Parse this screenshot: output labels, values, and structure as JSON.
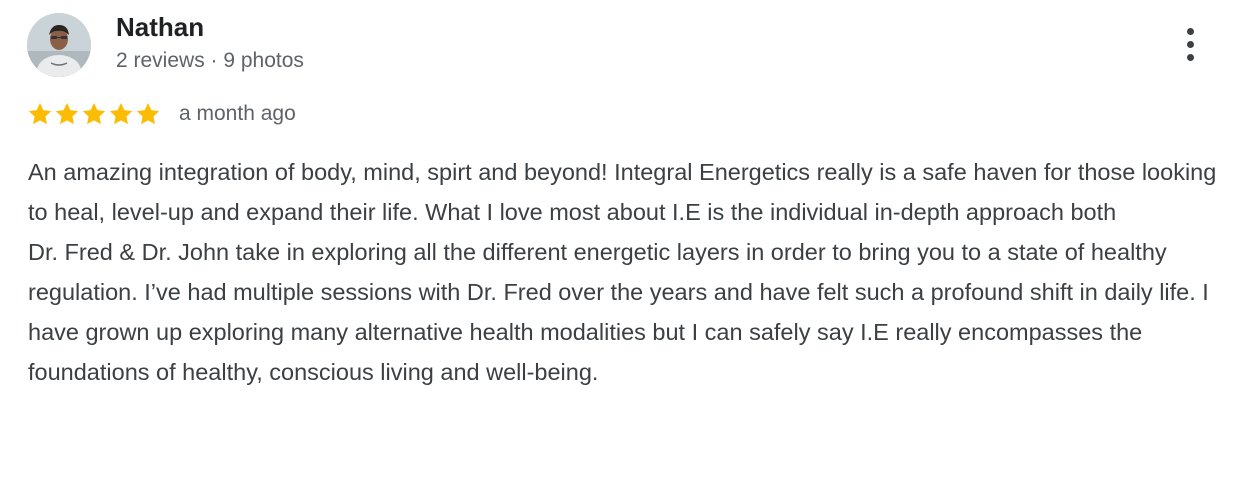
{
  "reviewer": {
    "name": "Nathan",
    "meta": "2 reviews · 9 photos",
    "avatar_icon": "user-photo-avatar"
  },
  "rating": {
    "stars": 5,
    "max_stars": 5,
    "star_color": "#fbbc04",
    "date": "a month ago"
  },
  "menu": {
    "icon": "more-vert-icon"
  },
  "review": {
    "paragraphs": [
      "An amazing integration of body, mind, spirt and beyond! Integral Energetics really is a safe haven for those looking to heal, level-up and expand their life. What I love most about I.E is the individual in-depth approach both",
      "Dr. Fred & Dr. John take in exploring all the different energetic layers in order to bring you to a state of healthy regulation. I’ve had multiple sessions with Dr. Fred over the years and have felt such a profound shift in daily life. I have grown up exploring many alternative health modalities but I can safely say I.E really encompasses the foundations of healthy, conscious living and well-being."
    ]
  }
}
